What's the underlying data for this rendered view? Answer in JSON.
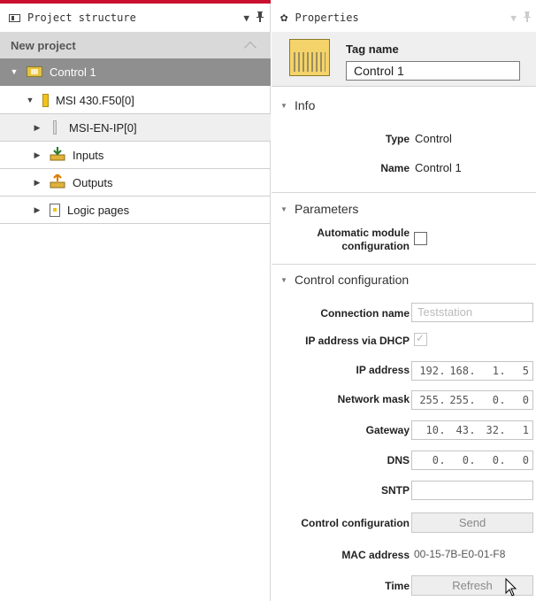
{
  "project_panel": {
    "title": "Project structure",
    "pin_icon": "pin-icon",
    "dropdown_icon": "chevron-down-icon",
    "project_name": "New project",
    "tree": [
      {
        "label": "Control 1",
        "icon": "control-icon",
        "selected": true
      },
      {
        "label": "MSI 430.F50[0]",
        "icon": "module-icon"
      },
      {
        "label": "MSI-EN-IP[0]",
        "icon": "module-icon"
      },
      {
        "label": "Inputs",
        "icon": "inputs-icon"
      },
      {
        "label": "Outputs",
        "icon": "outputs-icon"
      },
      {
        "label": "Logic pages",
        "icon": "page-icon"
      }
    ]
  },
  "properties_panel": {
    "title": "Properties",
    "tag_name_label": "Tag name",
    "tag_name_value": "Control 1",
    "info": {
      "heading": "Info",
      "type_label": "Type",
      "type_value": "Control",
      "name_label": "Name",
      "name_value": "Control 1"
    },
    "parameters": {
      "heading": "Parameters",
      "auto_config_label_1": "Automatic module",
      "auto_config_label_2": "configuration"
    },
    "control_config": {
      "heading": "Control configuration",
      "connection_name_label": "Connection name",
      "connection_name_placeholder": "Teststation",
      "dhcp_label": "IP address via DHCP",
      "ip_label": "IP address",
      "ip": [
        "192",
        "168",
        "1",
        "5"
      ],
      "mask_label": "Network mask",
      "mask": [
        "255",
        "255",
        "0",
        "0"
      ],
      "gateway_label": "Gateway",
      "gateway": [
        "10",
        "43",
        "32",
        "1"
      ],
      "dns_label": "DNS",
      "dns": [
        "0",
        "0",
        "0",
        "0"
      ],
      "sntp_label": "SNTP",
      "control_config_label": "Control configuration",
      "send_button": "Send",
      "mac_label": "MAC address",
      "mac_value": "00-15-7B-E0-01-F8",
      "time_label": "Time",
      "refresh_button": "Refresh"
    }
  },
  "colors": {
    "accent": "#c8102e",
    "selected_row": "#8f8f8f",
    "project_row": "#d9d9d9"
  }
}
